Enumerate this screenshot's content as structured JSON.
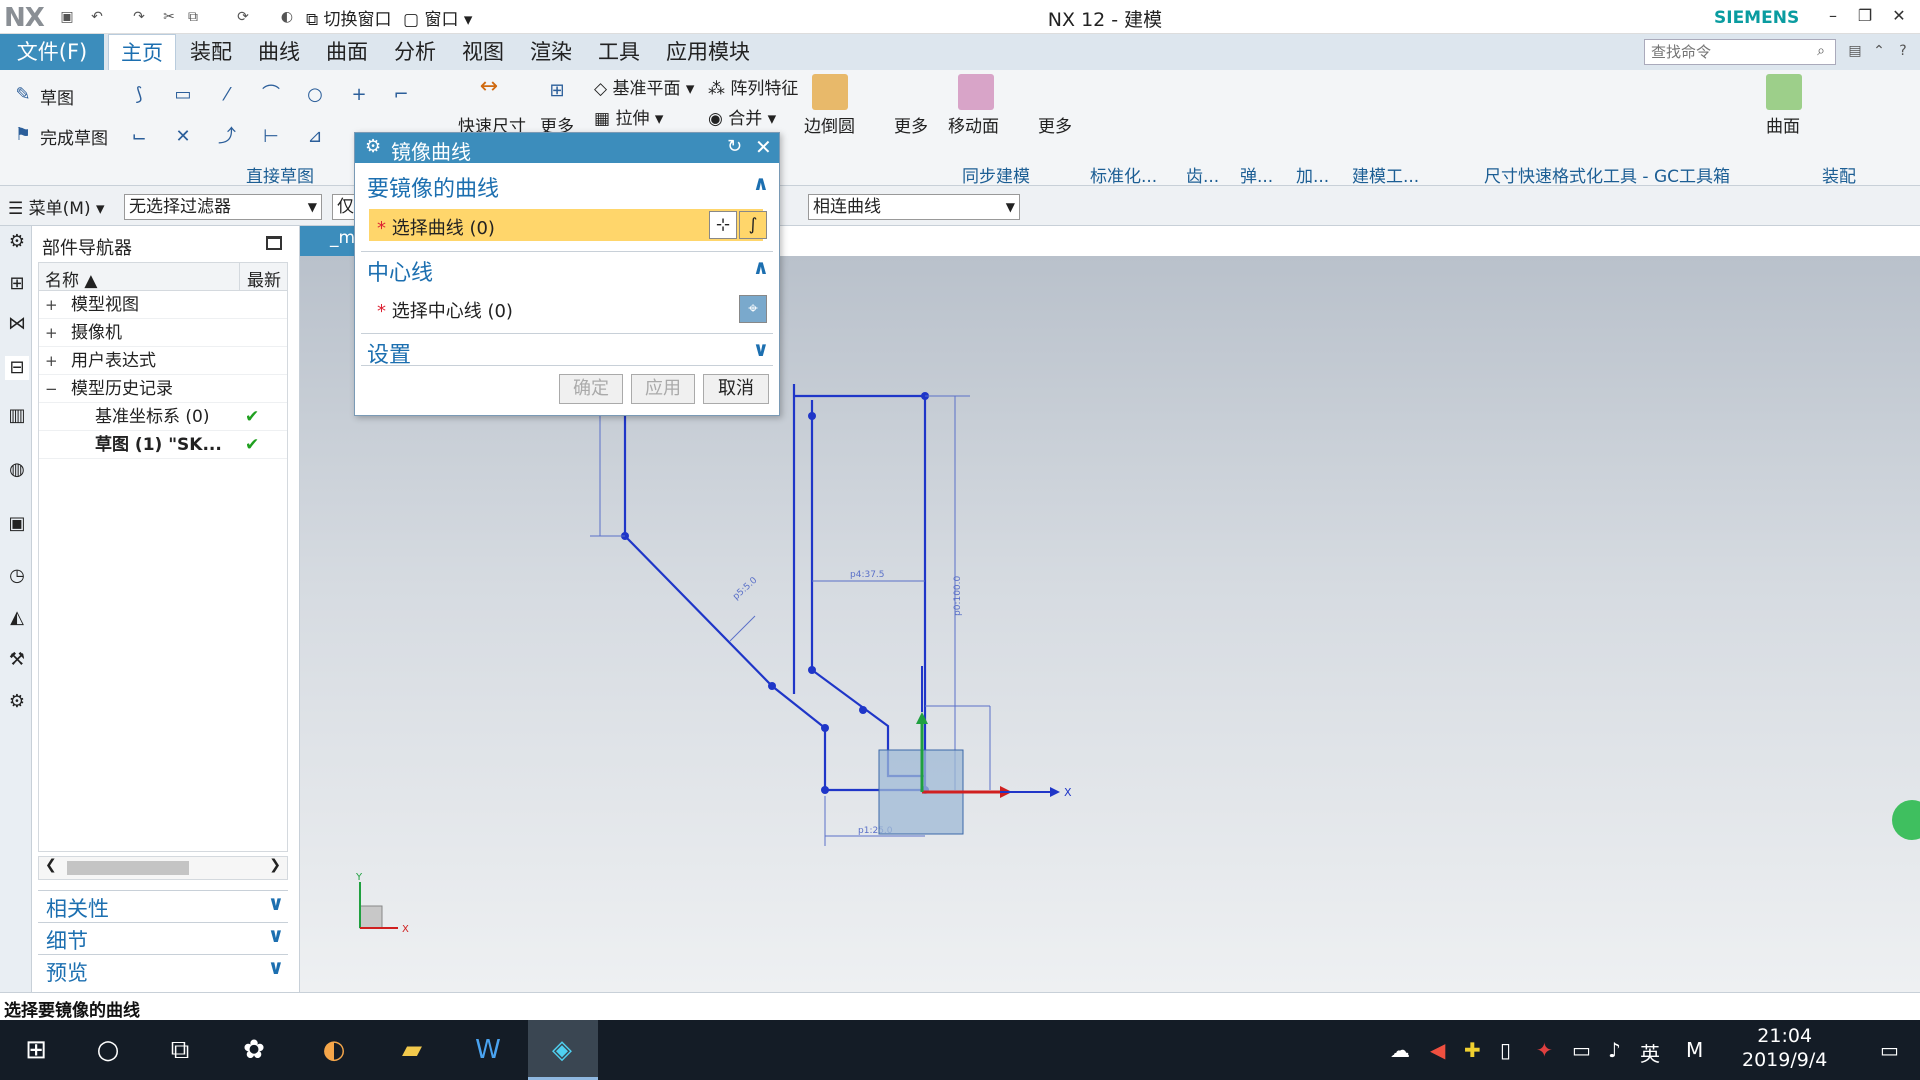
{
  "titlebar": {
    "logo": "NX",
    "title": "NX 12 - 建模",
    "brand": "SIEMENS",
    "switch_window": "切换窗口",
    "window": "窗口"
  },
  "menubar": {
    "file": "文件(F)",
    "items": [
      "主页",
      "装配",
      "曲线",
      "曲面",
      "分析",
      "视图",
      "渲染",
      "工具",
      "应用模块"
    ],
    "search_placeholder": "查找命令"
  },
  "ribbon": {
    "sketch": "草图",
    "finish_sketch": "完成草图",
    "direct_sketch": "直接草图",
    "quick_dim": "快速尺寸",
    "more1": "更多",
    "datum_plane": "基准平面",
    "extrude": "拉伸",
    "pattern_feature": "阵列特征",
    "unite": "合并",
    "edge_blend": "边倒圆",
    "more2": "更多",
    "move_face": "移动面",
    "more3": "更多",
    "sync_modeling": "同步建模",
    "groups": [
      "标准化...",
      "齿...",
      "弹...",
      "加...",
      "建模工...",
      "尺寸快速格式化工具 - GC工具箱"
    ],
    "surface": "曲面",
    "assembly": "装配"
  },
  "filterbar": {
    "menu": "菜单(M)",
    "filter": "无选择过滤器",
    "scope": "仅",
    "curve_rule": "相连曲线"
  },
  "navigator": {
    "title": "部件导航器",
    "col_name": "名称",
    "col_latest": "最新",
    "rows": [
      {
        "expander": "+",
        "label": "模型视图",
        "indent": 0,
        "ok": ""
      },
      {
        "expander": "+",
        "label": "摄像机",
        "indent": 0,
        "ok": ""
      },
      {
        "expander": "+",
        "label": "用户表达式",
        "indent": 0,
        "ok": ""
      },
      {
        "expander": "−",
        "label": "模型历史记录",
        "indent": 0,
        "ok": ""
      },
      {
        "expander": "",
        "label": "基准坐标系 (0)",
        "indent": 1,
        "ok": "✔"
      },
      {
        "expander": "",
        "label": "草图 (1) \"SK...",
        "indent": 1,
        "ok": "✔"
      }
    ],
    "sections": [
      "相关性",
      "细节",
      "预览"
    ]
  },
  "graphics": {
    "tab_label": "_mc"
  },
  "dialog": {
    "title": "镜像曲线",
    "section_curves": "要镜像的曲线",
    "select_curve": "选择曲线 (0)",
    "section_centerline": "中心线",
    "select_centerline": "选择中心线 (0)",
    "section_settings": "设置",
    "ok": "确定",
    "apply": "应用",
    "cancel": "取消"
  },
  "status": {
    "text": "选择要镜像的曲线"
  },
  "taskbar": {
    "ime": "英",
    "time": "21:04",
    "date": "2019/9/4"
  },
  "sketch": {
    "dims": [
      "p5:5.0",
      "p4:37.5",
      "p0:100.0",
      "p1:25.0"
    ]
  },
  "colors": {
    "accent": "#3c8dbc",
    "sketch_line": "#1f36c8",
    "highlight": "#ffd66b"
  }
}
